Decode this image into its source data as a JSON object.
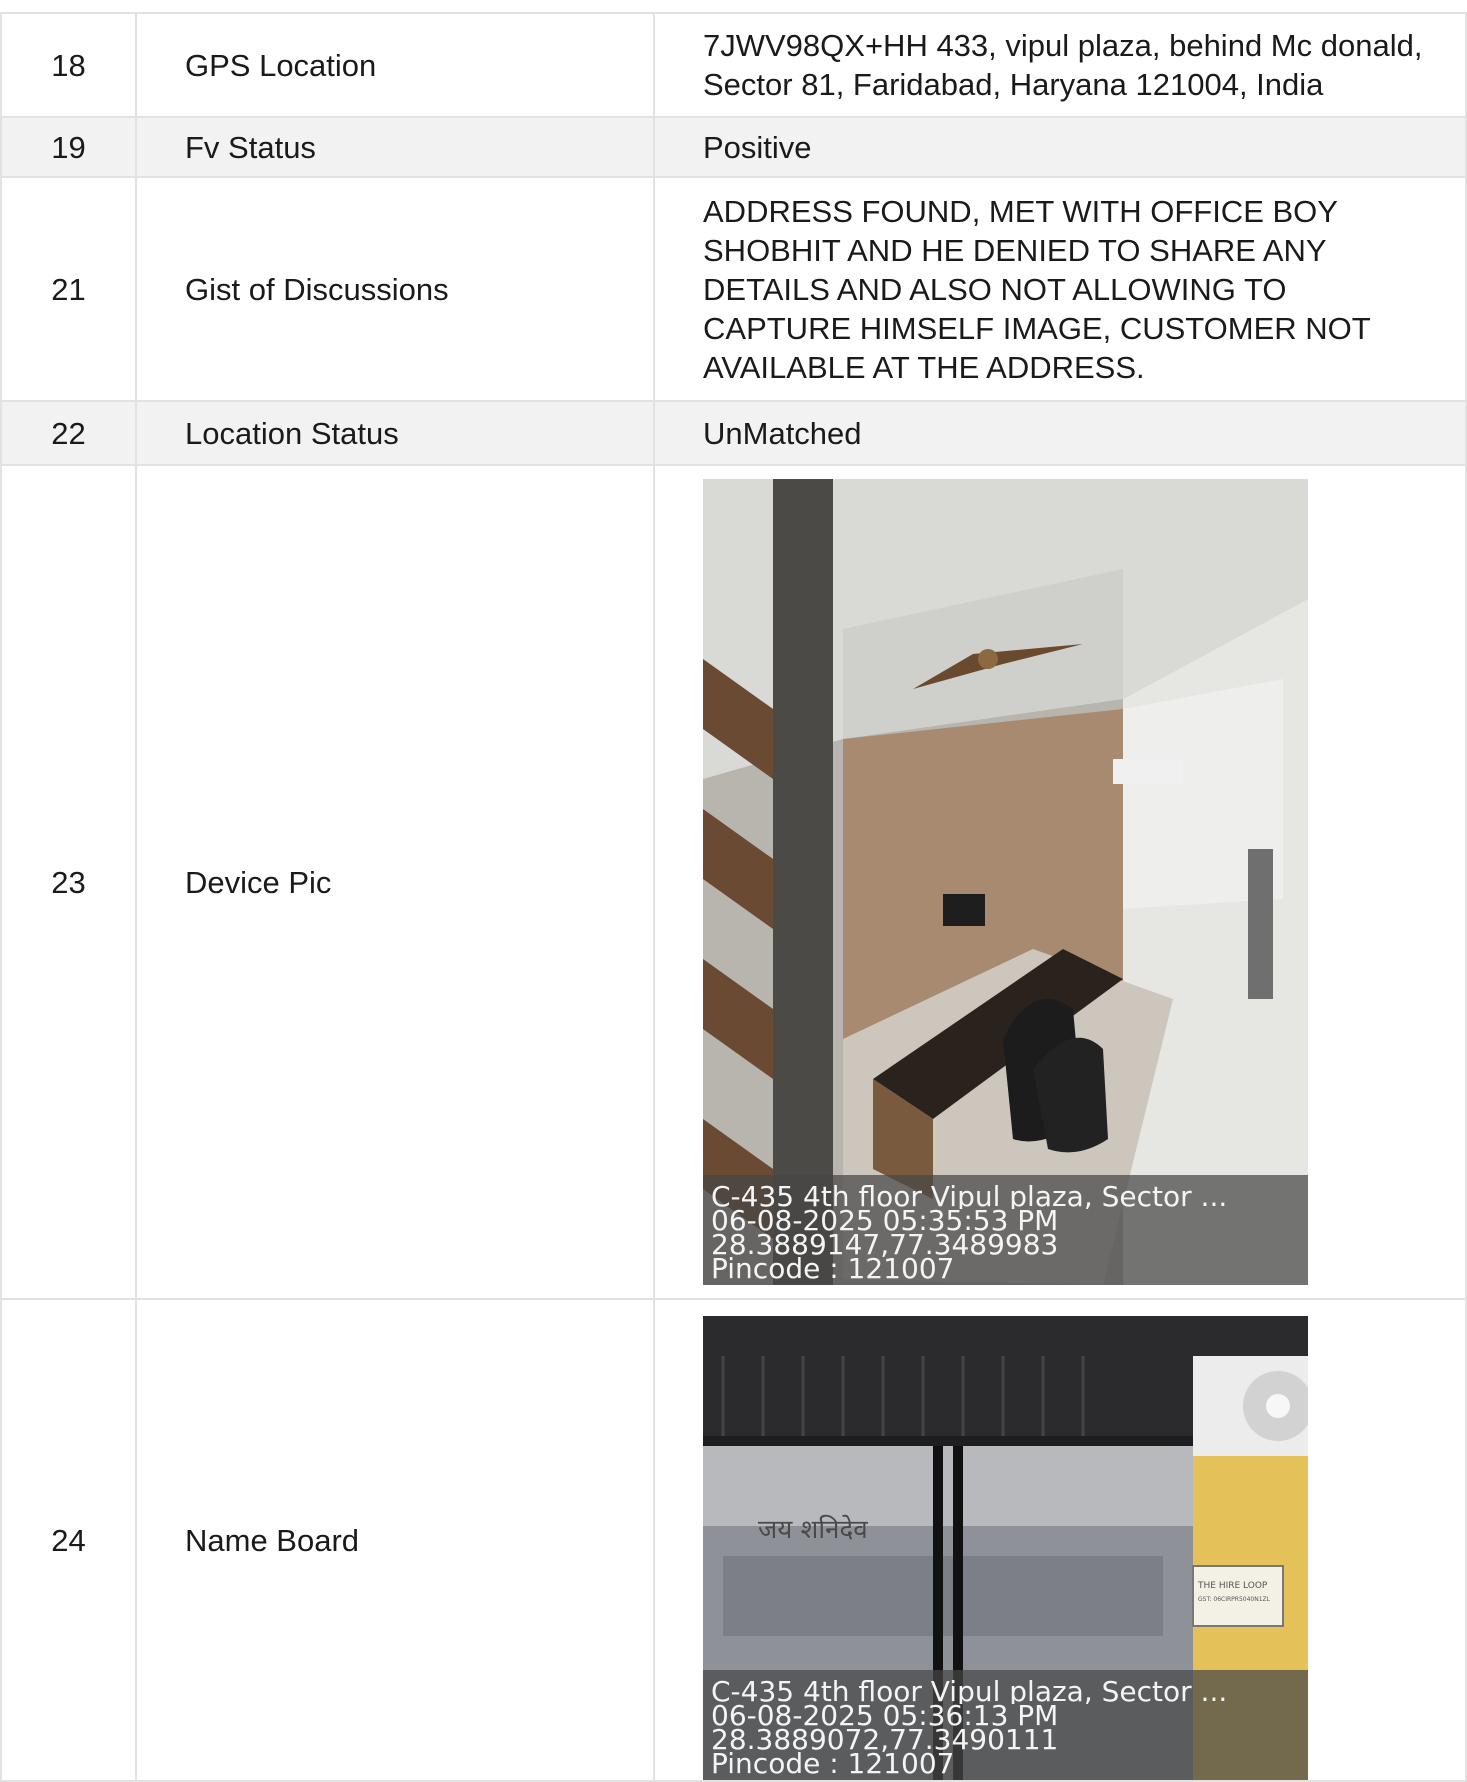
{
  "rows": [
    {
      "no": "18",
      "field": "GPS Location",
      "value": "7JWV98QX+HH 433, vipul plaza, behind Mc donald, Sector 81, Faridabad, Haryana 121004, India"
    },
    {
      "no": "19",
      "field": "Fv Status",
      "value": "Positive"
    },
    {
      "no": "21",
      "field": "Gist of Discussions",
      "value": "ADDRESS FOUND, MET WITH OFFICE BOY SHOBHIT AND HE DENIED TO SHARE ANY DETAILS AND ALSO NOT ALLOWING TO CAPTURE HIMSELF IMAGE, CUSTOMER NOT AVAILABLE AT THE ADDRESS."
    },
    {
      "no": "22",
      "field": "Location Status",
      "value": "UnMatched"
    },
    {
      "no": "23",
      "field": "Device Pic",
      "photo": {
        "caption": [
          "C-435 4th floor Vipul plaza, Sector ...",
          "06-08-2025 05:35:53 PM",
          "28.3889147,77.3489983",
          "Pincode : 121007"
        ]
      }
    },
    {
      "no": "24",
      "field": "Name Board",
      "photo": {
        "caption": [
          "C-435 4th floor Vipul plaza, Sector ...",
          "06-08-2025 05:36:13 PM",
          "28.3889072,77.3490111",
          "Pincode : 121007"
        ],
        "sign_text": "जय शनिदेव",
        "board_text": [
          "THE HIRE LOOP",
          "GST: 06CIRPR5040N1ZL"
        ]
      }
    }
  ]
}
